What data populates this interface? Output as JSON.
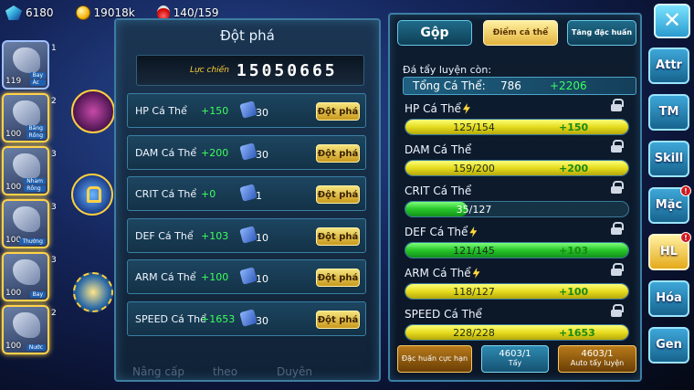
{
  "resources": {
    "gems": "6180",
    "gold": "19018k",
    "stamina": "140/159"
  },
  "roster": [
    {
      "level": "119",
      "tags": [
        "Bay",
        "Ác"
      ],
      "highlight": false
    },
    {
      "level": "100",
      "tags": [
        "Băng",
        "Rồng"
      ],
      "highlight": true
    },
    {
      "level": "100",
      "tags": [
        "Nham",
        "Rồng"
      ],
      "highlight": true
    },
    {
      "level": "100",
      "tags": [
        "Thường"
      ],
      "highlight": true
    },
    {
      "level": "100",
      "tags": [
        "Bay"
      ],
      "highlight": true
    },
    {
      "level": "100",
      "tags": [
        "Nước"
      ],
      "highlight": true
    }
  ],
  "side_numbers": [
    "1",
    "2",
    "3",
    "3",
    "3",
    "2"
  ],
  "left_panel": {
    "title": "Đột phá",
    "power_label": "Lực chiến",
    "power_value": "15050665",
    "breakthrough_label": "Đột phá",
    "rows": [
      {
        "label": "HP Cá Thể",
        "bonus": "+150",
        "qty": "30"
      },
      {
        "label": "DAM Cá Thể",
        "bonus": "+200",
        "qty": "30"
      },
      {
        "label": "CRIT Cá Thể",
        "bonus": "+0",
        "qty": "1"
      },
      {
        "label": "DEF Cá Thể",
        "bonus": "+103",
        "qty": "10"
      },
      {
        "label": "ARM Cá Thể",
        "bonus": "+100",
        "qty": "10"
      },
      {
        "label": "SPEED Cá Thể",
        "bonus": "+1653",
        "qty": "30"
      }
    ],
    "bottom_hidden": [
      "Nâng cấp",
      "theo",
      "Duyên"
    ]
  },
  "right_panel": {
    "tabs": {
      "gop": "Gộp",
      "diem": "Điểm cá thể",
      "tang": "Tăng đặc huấn"
    },
    "caption": "Đá tẩy luyện còn:",
    "total": {
      "label": "Tổng Cá Thể:",
      "value": "786",
      "bonus": "+2206"
    },
    "stats": [
      {
        "name": "HP Cá Thể",
        "value": "125/154",
        "bonus": "+150",
        "fill": 1.0,
        "color": "yellow",
        "bolt": true
      },
      {
        "name": "DAM Cá Thể",
        "value": "159/200",
        "bonus": "+200",
        "fill": 1.0,
        "color": "yellow",
        "bolt": false
      },
      {
        "name": "CRIT Cá Thể",
        "value": "35/127",
        "bonus": "",
        "fill": 0.28,
        "color": "green",
        "bolt": false
      },
      {
        "name": "DEF Cá Thể",
        "value": "121/145",
        "bonus": "+103",
        "fill": 1.0,
        "color": "green",
        "bolt": true
      },
      {
        "name": "ARM Cá Thể",
        "value": "118/127",
        "bonus": "+100",
        "fill": 1.0,
        "color": "yellow",
        "bolt": true
      },
      {
        "name": "SPEED Cá Thể",
        "value": "228/228",
        "bonus": "+1653",
        "fill": 1.0,
        "color": "yellow",
        "bolt": false
      }
    ],
    "actions": {
      "special": "Đặc huấn cực hạn",
      "wash_count": "4603/1",
      "wash_label": "Tẩy",
      "auto_count": "4603/1",
      "auto_label": "Auto tẩy luyện"
    }
  },
  "side_menu": [
    {
      "label": "Attr",
      "active": false,
      "badge": false
    },
    {
      "label": "TM",
      "active": false,
      "badge": false
    },
    {
      "label": "Skill",
      "active": false,
      "badge": false
    },
    {
      "label": "Mặc",
      "active": false,
      "badge": true
    },
    {
      "label": "HL",
      "active": true,
      "badge": true
    },
    {
      "label": "Hóa",
      "active": false,
      "badge": false
    },
    {
      "label": "Gen",
      "active": false,
      "badge": false
    }
  ],
  "close_label": "✕"
}
